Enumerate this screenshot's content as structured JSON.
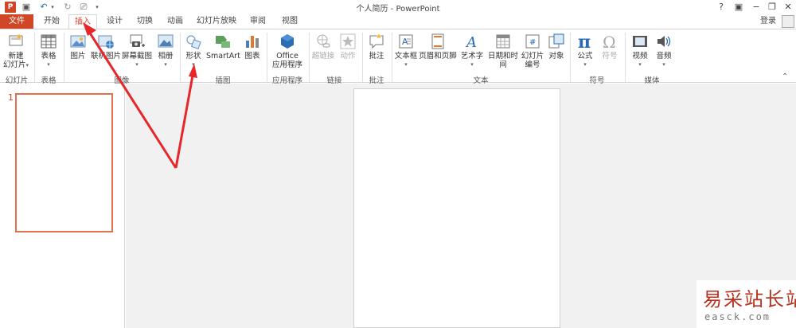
{
  "title_bar": {
    "title": "个人简历 - PowerPoint",
    "help": "?",
    "sign_in": "登录"
  },
  "tabs": [
    "文件",
    "开始",
    "插入",
    "设计",
    "切换",
    "动画",
    "幻灯片放映",
    "审阅",
    "视图"
  ],
  "active_tab": "插入",
  "ribbon": {
    "buttons": {
      "new_slide": "新建\n幻灯片",
      "table": "表格",
      "pictures": "图片",
      "online_pictures": "联机图片",
      "screenshot": "屏幕截图",
      "album": "相册",
      "shapes": "形状",
      "smartart": "SmartArt",
      "chart": "图表",
      "office_apps": "Office\n应用程序",
      "hyperlink": "超链接",
      "action": "动作",
      "comment": "批注",
      "textbox": "文本框",
      "header_footer": "页眉和页脚",
      "wordart": "艺术字",
      "date_time": "日期和时间",
      "slide_number": "幻灯片\n编号",
      "object": "对象",
      "equation": "公式",
      "symbol": "符号",
      "video": "视频",
      "audio": "音频"
    },
    "groups": {
      "slides": "幻灯片",
      "tables": "表格",
      "images": "图像",
      "illustrations": "插图",
      "apps": "应用程序",
      "links": "链接",
      "comments": "批注",
      "text": "文本",
      "symbols": "符号",
      "media": "媒体"
    }
  },
  "slides_pane": {
    "slide_number": "1"
  },
  "watermark": {
    "cn": "易采站长站",
    "en": "easck.com"
  },
  "colors": {
    "accent": "#d04727",
    "arrow": "#e8262a"
  }
}
